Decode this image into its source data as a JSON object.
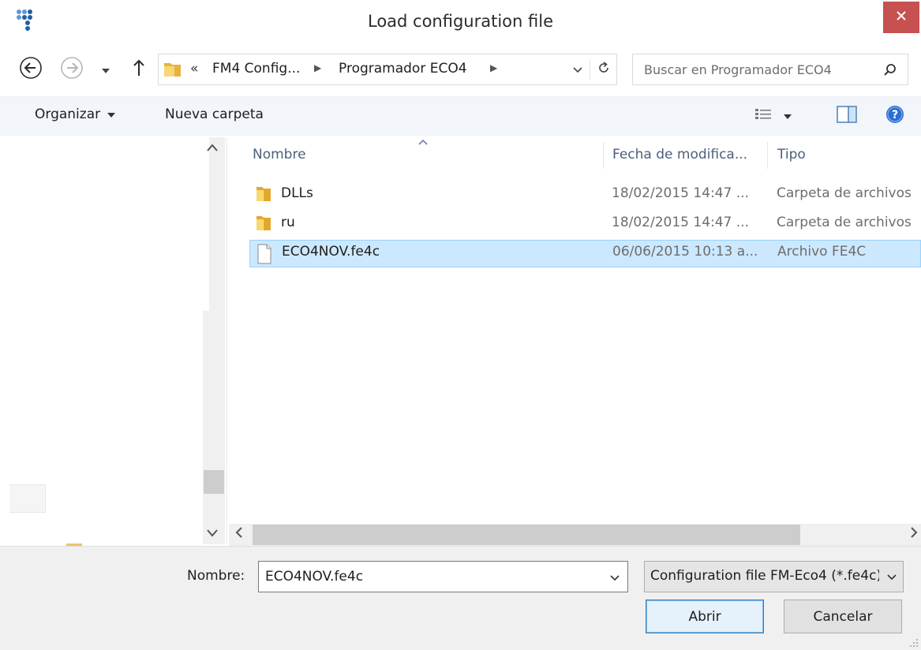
{
  "window": {
    "title": "Load configuration file",
    "icons": {
      "app": "app-logo-icon",
      "close": "close-icon"
    },
    "colors": {
      "close": "#c75050",
      "selection": "#cce8ff",
      "selection_border": "#99d1ff",
      "accent_button": "#3c7fb1"
    }
  },
  "address_bar": {
    "prefix": "«",
    "segments": [
      "FM4 Config...",
      "Programador ECO4"
    ],
    "separator": "▶"
  },
  "search": {
    "placeholder": "Buscar en Programador ECO4"
  },
  "toolbar": {
    "organize_label": "Organizar",
    "new_folder_label": "Nueva carpeta"
  },
  "file_list": {
    "columns": {
      "name": "Nombre",
      "date": "Fecha de modifica...",
      "type": "Tipo"
    },
    "rows": [
      {
        "name": "DLLs",
        "date": "18/02/2015 14:47 ...",
        "type": "Carpeta de archivos",
        "icon": "folder-icon"
      },
      {
        "name": "ru",
        "date": "18/02/2015 14:47 ...",
        "type": "Carpeta de archivos",
        "icon": "folder-icon"
      },
      {
        "name": "ECO4NOV.fe4c",
        "date": "06/06/2015 10:13 a...",
        "type": "Archivo FE4C",
        "icon": "file-icon"
      }
    ]
  },
  "footer": {
    "filename_label": "Nombre:",
    "filename_value": "ECO4NOV.fe4c",
    "filter_value": "Configuration file FM-Eco4 (*.fe4c)",
    "open_label": "Abrir",
    "cancel_label": "Cancelar"
  }
}
